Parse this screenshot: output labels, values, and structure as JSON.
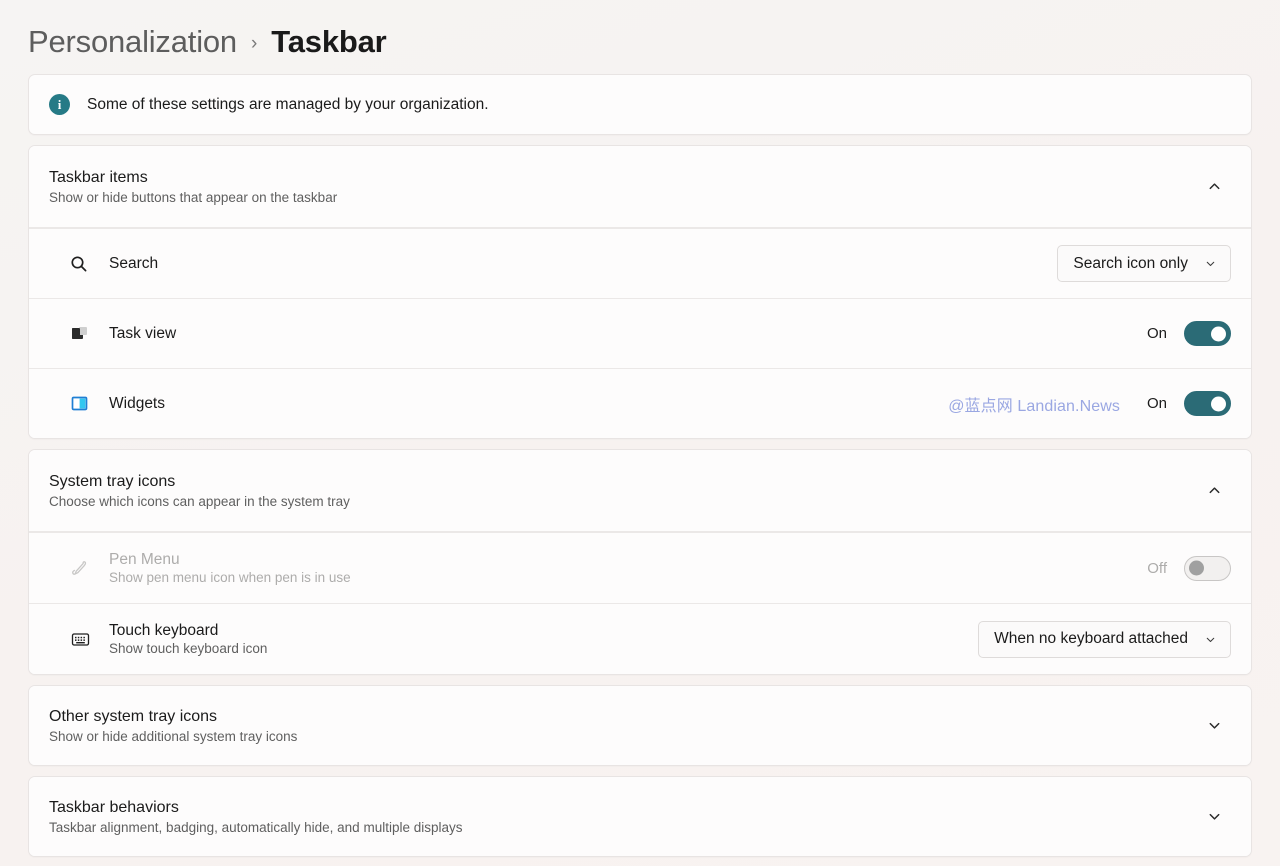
{
  "breadcrumb": {
    "parent": "Personalization",
    "separator": "›",
    "current": "Taskbar"
  },
  "banner": {
    "icon": "info-icon",
    "text": "Some of these settings are managed by your organization."
  },
  "watermark": "@蓝点网 Landian.News",
  "sections": [
    {
      "id": "taskbar-items",
      "title": "Taskbar items",
      "subtitle": "Show or hide buttons that appear on the taskbar",
      "expanded": true,
      "chevron": "chevron-up-icon",
      "rows": [
        {
          "id": "search",
          "icon": "search-icon",
          "label": "Search",
          "control": "combo",
          "value": "Search icon only",
          "caret": "chevron-down-icon"
        },
        {
          "id": "task-view",
          "icon": "task-view-icon",
          "label": "Task view",
          "control": "toggle",
          "state": "On",
          "on": true
        },
        {
          "id": "widgets",
          "icon": "widgets-icon",
          "label": "Widgets",
          "control": "toggle",
          "state": "On",
          "on": true
        }
      ]
    },
    {
      "id": "system-tray-icons",
      "title": "System tray icons",
      "subtitle": "Choose which icons can appear in the system tray",
      "expanded": true,
      "chevron": "chevron-up-icon",
      "rows": [
        {
          "id": "pen-menu",
          "icon": "pen-icon",
          "label": "Pen Menu",
          "sublabel": "Show pen menu icon when pen is in use",
          "control": "toggle",
          "state": "Off",
          "on": false,
          "disabled": true
        },
        {
          "id": "touch-keyboard",
          "icon": "keyboard-icon",
          "label": "Touch keyboard",
          "sublabel": "Show touch keyboard icon",
          "control": "combo",
          "value": "When no keyboard attached",
          "caret": "chevron-down-icon"
        }
      ]
    },
    {
      "id": "other-system-tray-icons",
      "title": "Other system tray icons",
      "subtitle": "Show or hide additional system tray icons",
      "expanded": false,
      "chevron": "chevron-down-icon",
      "rows": []
    },
    {
      "id": "taskbar-behaviors",
      "title": "Taskbar behaviors",
      "subtitle": "Taskbar alignment, badging, automatically hide, and multiple displays",
      "expanded": false,
      "chevron": "chevron-down-icon",
      "rows": []
    }
  ],
  "colors": {
    "accent_teal": "#2b6b76",
    "info_teal": "#267a86",
    "page_bg": "#f7f3f2",
    "card_bg": "#fdfcfc",
    "watermark": "#9aa7e2"
  }
}
